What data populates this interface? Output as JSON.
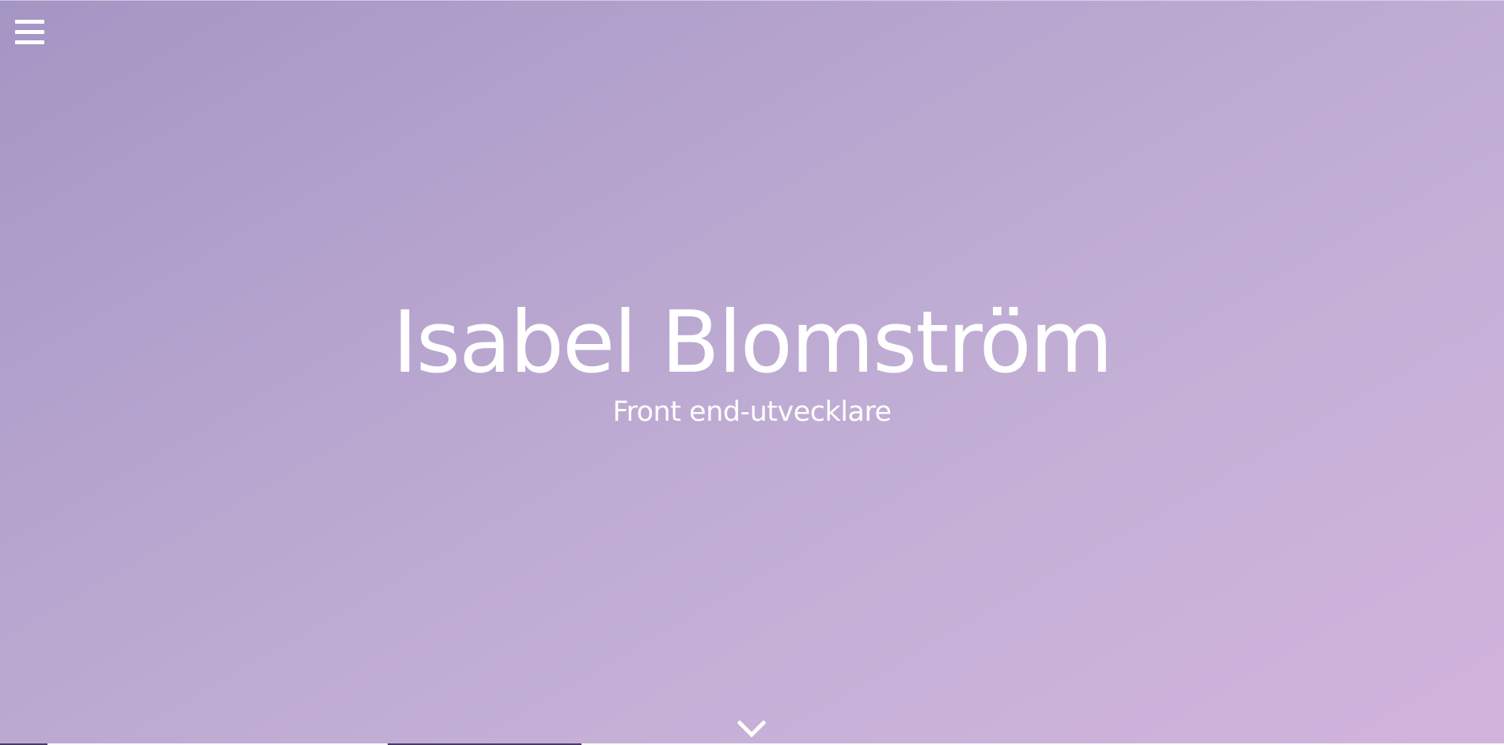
{
  "navigation": {
    "menu_icon": "hamburger-menu-icon"
  },
  "hero": {
    "name": "Isabel Blomström",
    "role": "Front end-utvecklare",
    "scroll_icon": "chevron-down-icon",
    "background_start": "#a495c4",
    "background_end": "#d2b3dc",
    "text_color": "#ffffff"
  }
}
